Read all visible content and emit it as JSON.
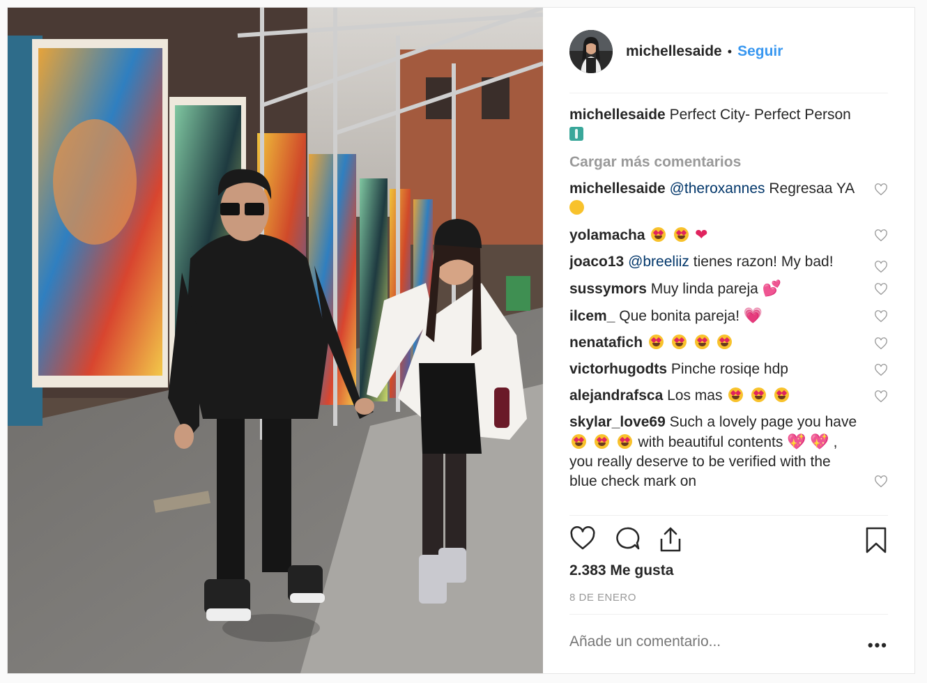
{
  "post": {
    "username": "michellesaide",
    "follow_label": "Seguir",
    "separator": "•",
    "caption_user": "michellesaide",
    "caption_text": "Perfect City- Perfect Person",
    "load_more": "Cargar más comentarios",
    "likes": "2.383 Me gusta",
    "date": "8 DE ENERO",
    "add_comment_placeholder": "Añade un comentario...",
    "more_options": "•••"
  },
  "comments": [
    {
      "user": "michellesaide",
      "mention": "@theroxannes",
      "text": "Regresaa YA"
    },
    {
      "user": "yolamacha",
      "text": ""
    },
    {
      "user": "joaco13",
      "mention": "@breeliiz",
      "text": "tienes razon! My bad!"
    },
    {
      "user": "sussymors",
      "text": "Muy linda pareja"
    },
    {
      "user": "ilcem_",
      "text": "Que bonita pareja!"
    },
    {
      "user": "nenatafich",
      "text": ""
    },
    {
      "user": "victorhugodts",
      "text": "Pinche rosiqe hdp"
    },
    {
      "user": "alejandrafsca",
      "text": "Los mas"
    },
    {
      "user": "skylar_love69",
      "text_a": "Such a lovely page you have",
      "text_b": "with beautiful contents",
      "text_c": ", you really deserve to be verified with the blue check mark on"
    }
  ],
  "icons": {
    "like": "heart-outline-icon",
    "comment": "speech-bubble-icon",
    "share": "share-upload-icon",
    "save": "bookmark-icon"
  },
  "colors": {
    "link_blue": "#3897f0",
    "mention": "#003569",
    "muted": "#999999",
    "text": "#262626"
  }
}
